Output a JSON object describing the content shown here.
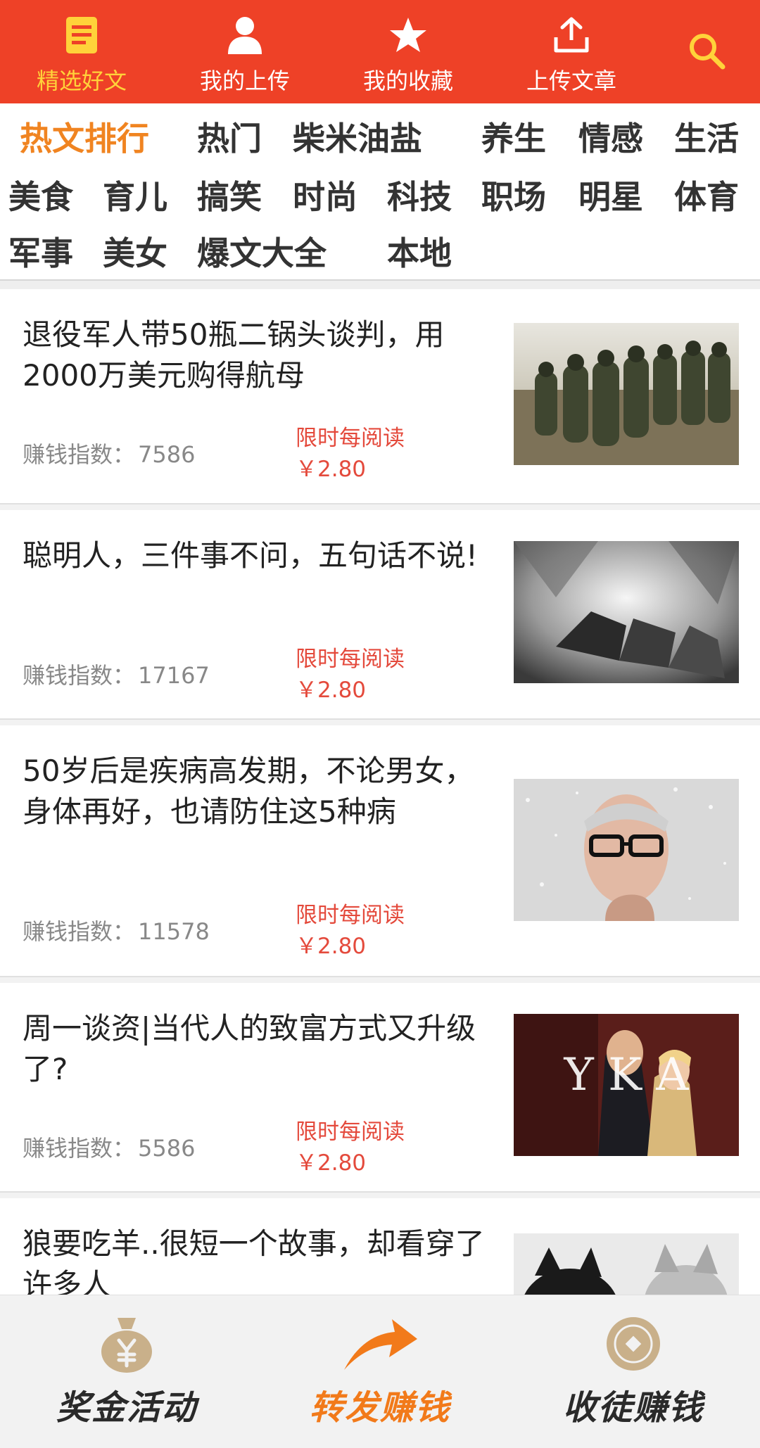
{
  "top_nav": {
    "items": [
      {
        "label": "精选好文",
        "icon": "document-icon",
        "active": true
      },
      {
        "label": "我的上传",
        "icon": "user-icon",
        "active": false
      },
      {
        "label": "我的收藏",
        "icon": "star-icon",
        "active": false
      },
      {
        "label": "上传文章",
        "icon": "upload-icon",
        "active": false
      }
    ],
    "search_icon": "search-icon",
    "colors": {
      "bar": "#ee4127",
      "active": "#ffd23a",
      "text": "#ffffff"
    }
  },
  "categories": {
    "items": [
      "热文排行",
      "热门",
      "柴米油盐",
      "养生",
      "情感",
      "生活",
      "美食",
      "育儿",
      "搞笑",
      "时尚",
      "科技",
      "职场",
      "明星",
      "体育",
      "军事",
      "美女",
      "爆文大全",
      "本地"
    ],
    "active_index": 0,
    "colors": {
      "active": "#f08421",
      "normal": "#333333"
    }
  },
  "articles": [
    {
      "title": "退役军人带50瓶二锅头谈判，用2000万美元购得航母",
      "meta_label": "赚钱指数：",
      "meta_value": "7586",
      "promo_line1": "限时每阅读",
      "promo_line2": "￥2.80",
      "thumb": "soldiers-thumbnail"
    },
    {
      "title": "聪明人，三件事不问，五句话不说!",
      "meta_label": "赚钱指数：",
      "meta_value": "17167",
      "promo_line1": "限时每阅读",
      "promo_line2": "￥2.80",
      "thumb": "abstract-rocks-thumbnail"
    },
    {
      "title": "50岁后是疾病高发期，不论男女，身体再好，也请防住这5种病",
      "meta_label": "赚钱指数：",
      "meta_value": "11578",
      "promo_line1": "限时每阅读",
      "promo_line2": "￥2.80",
      "thumb": "older-man-thumbnail"
    },
    {
      "title": "周一谈资|当代人的致富方式又升级了?",
      "meta_label": "赚钱指数：",
      "meta_value": "5586",
      "promo_line1": "限时每阅读",
      "promo_line2": "￥2.80",
      "thumb": "movie-couple-thumbnail",
      "thumb_text": "Y  K  A"
    },
    {
      "title": "狼要吃羊..很短一个故事，却看穿了许多人",
      "thumb": "wolf-thumbnail"
    }
  ],
  "bottom_tabs": [
    {
      "label": "奖金活动",
      "icon": "money-bag-icon",
      "active": false
    },
    {
      "label": "转发赚钱",
      "icon": "share-arrow-icon",
      "active": true
    },
    {
      "label": "收徒赚钱",
      "icon": "coin-icon",
      "active": false
    }
  ]
}
